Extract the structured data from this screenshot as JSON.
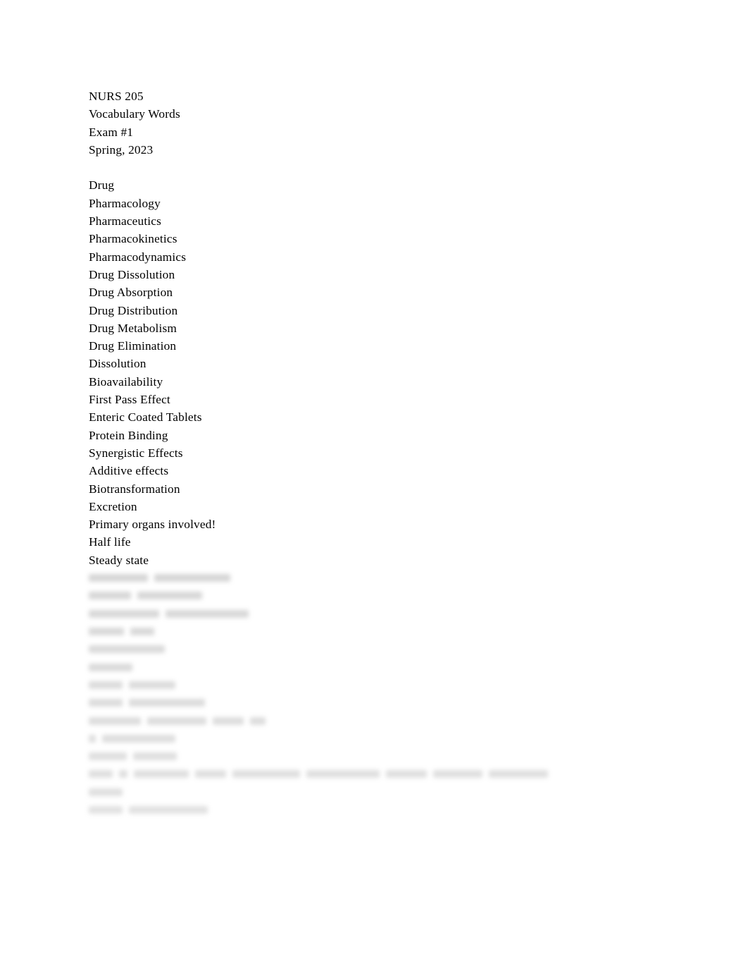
{
  "document": {
    "background_color": "#ffffff",
    "text_color": "#000000",
    "header": {
      "course_code": "NURS 205",
      "doc_title": "Vocabulary Words",
      "exam": "Exam #1",
      "term": "Spring, 2023"
    },
    "blank_line": "",
    "vocabulary_terms_legible": [
      "Drug",
      "Pharmacology",
      "Pharmaceutics",
      "Pharmacokinetics",
      "Pharmacodynamics",
      "Drug Dissolution",
      "Drug Absorption",
      "Drug Distribution",
      "Drug Metabolism",
      "Drug Elimination",
      "Dissolution",
      "Bioavailability",
      "First Pass Effect",
      "Enteric Coated Tablets",
      "Protein Binding",
      "Synergistic Effects",
      "Additive effects",
      "Biotransformation",
      "Excretion",
      "Primary organs involved!",
      "Half life",
      "Steady state"
    ],
    "vocabulary_terms_obscured": [
      "                    ",
      "                 ",
      "                       ",
      "            ",
      "              ",
      "        ",
      "              ",
      "                  ",
      "                          ",
      "               ",
      "              ",
      "                                                                                 ",
      "         ",
      "                  "
    ]
  }
}
